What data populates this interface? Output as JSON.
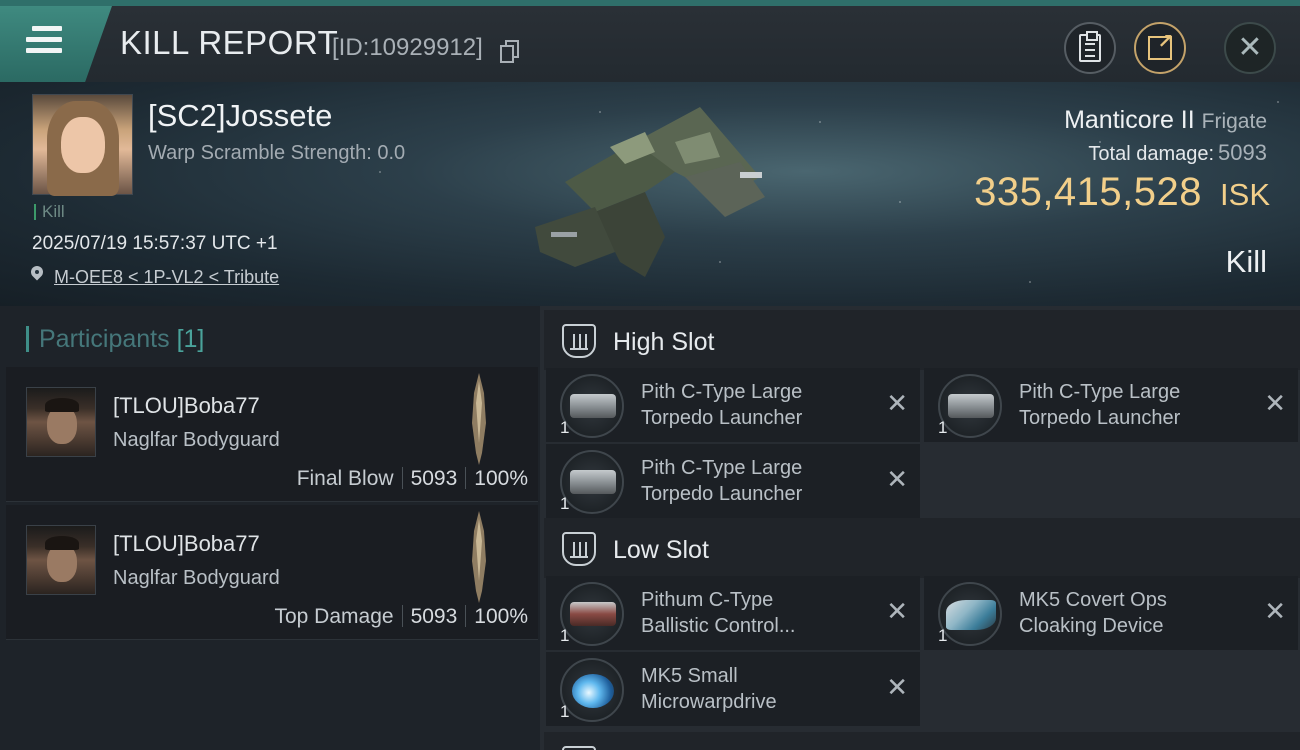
{
  "header": {
    "title": "KILL REPORT",
    "report_id": "[ID:10929912]",
    "icons": [
      "menu-icon",
      "copy-icon",
      "clipboard-icon",
      "share-icon",
      "close-icon"
    ]
  },
  "victim": {
    "name": "[SC2]Jossete",
    "warp_scramble": "Warp Scramble Strength: 0.0",
    "tag": "Kill",
    "datetime": "2025/07/19 15:57:37 UTC +1",
    "location": "M-OEE8 < 1P-VL2 < Tribute",
    "ship_name": "Manticore II",
    "ship_class": "Frigate",
    "total_damage_label": "Total damage:",
    "total_damage": "5093",
    "isk_value": "335,415,528",
    "isk_label": "ISK",
    "result": "Kill"
  },
  "participants": {
    "label": "Participants",
    "count": "[1]",
    "items": [
      {
        "name": "[TLOU]Boba77",
        "ship": "Naglfar Bodyguard",
        "stat_label": "Final Blow",
        "damage": "5093",
        "percent": "100%"
      },
      {
        "name": "[TLOU]Boba77",
        "ship": "Naglfar Bodyguard",
        "stat_label": "Top Damage",
        "damage": "5093",
        "percent": "100%"
      }
    ]
  },
  "fitting": {
    "high_slot": {
      "title": "High Slot",
      "modules": [
        {
          "line1": "Pith C-Type Large",
          "line2": "Torpedo Launcher",
          "qty": "1"
        },
        {
          "line1": "Pith C-Type Large",
          "line2": "Torpedo Launcher",
          "qty": "1"
        },
        {
          "line1": "Pith C-Type Large",
          "line2": "Torpedo Launcher",
          "qty": "1"
        }
      ]
    },
    "low_slot": {
      "title": "Low Slot",
      "modules": [
        {
          "line1": "Pithum C-Type",
          "line2": "Ballistic Control...",
          "qty": "1"
        },
        {
          "line1": "MK5 Covert Ops",
          "line2": "Cloaking Device",
          "qty": "1"
        },
        {
          "line1": "MK5 Small",
          "line2": "Microwarpdrive",
          "qty": "1"
        }
      ]
    },
    "remove_glyph": "✕"
  }
}
